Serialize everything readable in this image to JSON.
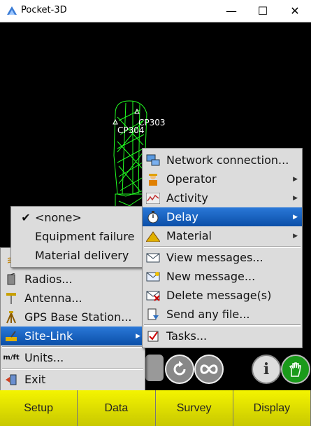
{
  "window": {
    "title": "Pocket-3D",
    "minimize_glyph": "—",
    "maximize_glyph": "☐",
    "close_glyph": "✕"
  },
  "map": {
    "points": [
      "CP303",
      "CP304"
    ]
  },
  "setup_menu": {
    "items": [
      {
        "label": "Radios...",
        "icon": "radio-icon"
      },
      {
        "label": "Antenna...",
        "icon": "antenna-icon"
      },
      {
        "label": "GPS Base Station...",
        "icon": "gps-base-station-icon"
      },
      {
        "label": "Site-Link",
        "icon": "site-link-icon",
        "selected": true
      },
      {
        "label": "Units...",
        "icon": "units-icon",
        "icon_text": "m/ft"
      },
      {
        "label": "Exit",
        "icon": "exit-icon"
      }
    ]
  },
  "delay_submenu": {
    "items": [
      {
        "label": "<none>",
        "checked": true
      },
      {
        "label": "Equipment failure"
      },
      {
        "label": "Material delivery"
      }
    ]
  },
  "sitelink_menu": {
    "items": [
      {
        "label": "Network connection...",
        "icon": "network-icon"
      },
      {
        "label": "Operator",
        "icon": "operator-icon",
        "submenu": true
      },
      {
        "label": "Activity",
        "icon": "activity-icon",
        "submenu": true
      },
      {
        "label": "Delay",
        "icon": "stopwatch-icon",
        "submenu": true,
        "selected": true
      },
      {
        "label": "Material",
        "icon": "material-icon",
        "submenu": true
      },
      {
        "label": "View messages...",
        "icon": "view-messages-icon"
      },
      {
        "label": "New message...",
        "icon": "new-message-icon"
      },
      {
        "label": "Delete message(s)",
        "icon": "delete-message-icon"
      },
      {
        "label": "Send any file...",
        "icon": "send-file-icon"
      },
      {
        "label": "Tasks...",
        "icon": "tasks-icon"
      }
    ]
  },
  "bottom_bar": {
    "setup": "Setup",
    "data": "Data",
    "survey": "Survey",
    "display": "Display"
  },
  "colors": {
    "accent": "#0b4fa8",
    "bar": "#e8e800",
    "mesh": "#22ff22"
  }
}
